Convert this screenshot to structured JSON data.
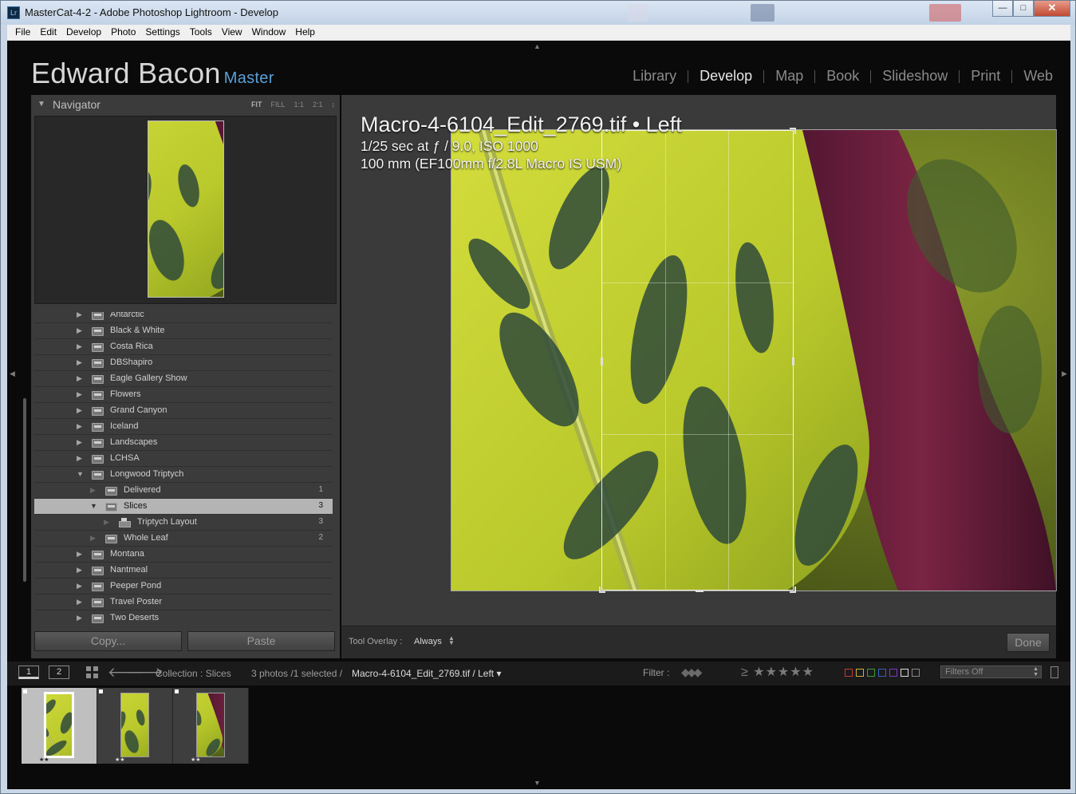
{
  "window": {
    "title": "MasterCat-4-2 - Adobe Photoshop Lightroom - Develop",
    "app_icon": "Lr",
    "controls": {
      "minimize": "—",
      "maximize": "□",
      "close": "✕"
    }
  },
  "menu": [
    "File",
    "Edit",
    "Develop",
    "Photo",
    "Settings",
    "Tools",
    "View",
    "Window",
    "Help"
  ],
  "identity": {
    "name": "Edward Bacon",
    "subtitle": "Master"
  },
  "modules": [
    {
      "label": "Library",
      "active": false
    },
    {
      "label": "Develop",
      "active": true
    },
    {
      "label": "Map",
      "active": false
    },
    {
      "label": "Book",
      "active": false
    },
    {
      "label": "Slideshow",
      "active": false
    },
    {
      "label": "Print",
      "active": false
    },
    {
      "label": "Web",
      "active": false
    }
  ],
  "navigator": {
    "title": "Navigator",
    "zoom": [
      {
        "label": "FIT",
        "active": true
      },
      {
        "label": "FILL",
        "active": false
      },
      {
        "label": "1:1",
        "active": false
      },
      {
        "label": "2:1",
        "active": false
      }
    ],
    "zoom_arrows": "↕"
  },
  "collections": [
    {
      "label": "Antarctic",
      "level": 0,
      "icon": "collection-set-icon",
      "count": "",
      "selected": false
    },
    {
      "label": "Black & White",
      "level": 0,
      "icon": "collection-set-icon",
      "count": "",
      "selected": false
    },
    {
      "label": "Costa Rica",
      "level": 0,
      "icon": "collection-set-icon",
      "count": "",
      "selected": false
    },
    {
      "label": "DBShapiro",
      "level": 0,
      "icon": "collection-set-icon",
      "count": "",
      "selected": false
    },
    {
      "label": "Eagle Gallery Show",
      "level": 0,
      "icon": "collection-set-icon",
      "count": "",
      "selected": false
    },
    {
      "label": "Flowers",
      "level": 0,
      "icon": "collection-set-icon",
      "count": "",
      "selected": false
    },
    {
      "label": "Grand Canyon",
      "level": 0,
      "icon": "collection-set-icon",
      "count": "",
      "selected": false
    },
    {
      "label": "Iceland",
      "level": 0,
      "icon": "collection-set-icon",
      "count": "",
      "selected": false
    },
    {
      "label": "Landscapes",
      "level": 0,
      "icon": "collection-set-icon",
      "count": "",
      "selected": false
    },
    {
      "label": "LCHSA",
      "level": 0,
      "icon": "collection-set-icon",
      "count": "",
      "selected": false
    },
    {
      "label": "Longwood Triptych",
      "level": 0,
      "icon": "collection-set-icon",
      "count": "",
      "selected": false,
      "expanded": true
    },
    {
      "label": "Delivered",
      "level": 1,
      "icon": "collection-set-icon",
      "count": "1",
      "selected": false
    },
    {
      "label": "Slices",
      "level": 1,
      "icon": "collection-set-icon",
      "count": "3",
      "selected": true,
      "expanded": true
    },
    {
      "label": "Triptych Layout",
      "level": 2,
      "icon": "print-icon",
      "count": "3",
      "selected": false
    },
    {
      "label": "Whole Leaf",
      "level": 1,
      "icon": "collection-set-icon",
      "count": "2",
      "selected": false
    },
    {
      "label": "Montana",
      "level": 0,
      "icon": "collection-set-icon",
      "count": "",
      "selected": false
    },
    {
      "label": "Nantmeal",
      "level": 0,
      "icon": "collection-set-icon",
      "count": "",
      "selected": false
    },
    {
      "label": "Peeper Pond",
      "level": 0,
      "icon": "collection-set-icon",
      "count": "",
      "selected": false
    },
    {
      "label": "Travel Poster",
      "level": 0,
      "icon": "collection-set-icon",
      "count": "",
      "selected": false
    },
    {
      "label": "Two Deserts",
      "level": 0,
      "icon": "collection-set-icon",
      "count": "",
      "selected": false
    }
  ],
  "buttons": {
    "copy": "Copy...",
    "paste": "Paste",
    "done": "Done"
  },
  "info_overlay": {
    "title": "Macro-4-6104_Edit_2769.tif • Left",
    "line1": "1/25 sec at ƒ / 9.0, ISO 1000",
    "line2": "100 mm (EF100mm f/2.8L Macro IS USM)"
  },
  "toolbar": {
    "tool_overlay_label": "Tool Overlay :",
    "tool_overlay_value": "Always"
  },
  "filmstrip_bar": {
    "screen1": "1",
    "screen2": "2",
    "collection": "Collection : Slices",
    "count": "3 photos /1 selected /",
    "file": "Macro-4-6104_Edit_2769.tif / Left",
    "file_arrow": "▾",
    "filter_label": "Filter :",
    "flags": "◆◆◆",
    "stars": "≥ ★★★★★",
    "color_labels": [
      "#c23a3a",
      "#c9b33a",
      "#3a9c3a",
      "#3a5fc2",
      "#7a3ac2",
      "#dcdcdc",
      "#888888"
    ],
    "filters_value": "Filters Off"
  },
  "filmstrip": [
    {
      "stars": "★★",
      "selected": true
    },
    {
      "stars": "★★",
      "selected": false
    },
    {
      "stars": "★★",
      "selected": false
    }
  ],
  "colors": {
    "accent": "#5aa0d6",
    "leaf_yellow": "#c8d43a",
    "leaf_purple": "#6e1e3e"
  }
}
